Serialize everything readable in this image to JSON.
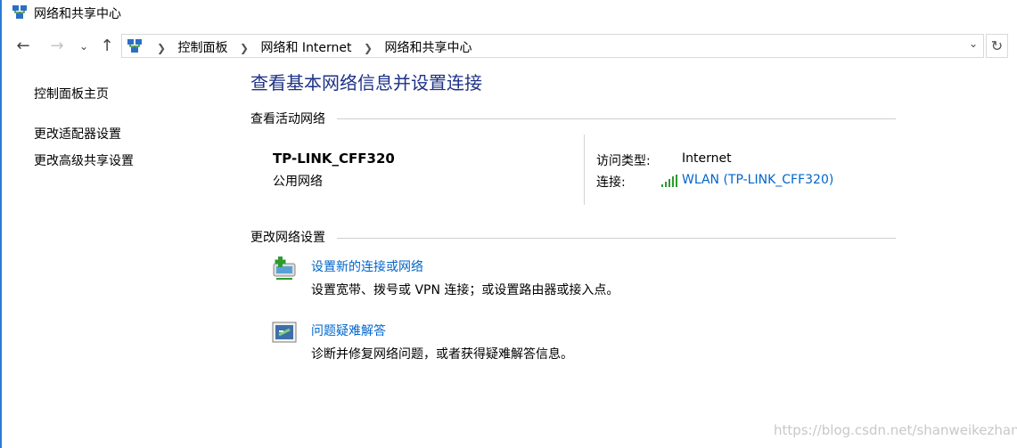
{
  "window": {
    "title": "网络和共享中心"
  },
  "nav": {
    "back_icon": "arrow-left-icon",
    "forward_icon": "arrow-right-icon",
    "recent_icon": "chevron-down-icon",
    "up_icon": "arrow-up-icon",
    "breadcrumb": [
      "控制面板",
      "网络和 Internet",
      "网络和共享中心"
    ],
    "refresh_icon": "refresh-icon"
  },
  "sidebar": {
    "items": [
      {
        "label": "控制面板主页"
      },
      {
        "label": "更改适配器设置"
      },
      {
        "label": "更改高级共享设置"
      }
    ]
  },
  "main": {
    "title": "查看基本网络信息并设置连接",
    "active_section_label": "查看活动网络",
    "network": {
      "name": "TP-LINK_CFF320",
      "type": "公用网络",
      "access_label": "访问类型:",
      "access_value": "Internet",
      "connection_label": "连接:",
      "connection_value": "WLAN (TP-LINK_CFF320)"
    },
    "change_section_label": "更改网络设置",
    "tasks": [
      {
        "title": "设置新的连接或网络",
        "description": "设置宽带、拨号或 VPN 连接；或设置路由器或接入点。",
        "icon": "new-connection-icon"
      },
      {
        "title": "问题疑难解答",
        "description": "诊断并修复网络问题，或者获得疑难解答信息。",
        "icon": "troubleshoot-icon"
      }
    ]
  },
  "watermark": "https://blog.csdn.net/shanweikezhang",
  "colors": {
    "link": "#0066cc",
    "title": "#1e3287",
    "accent": "#2b7cd3"
  }
}
